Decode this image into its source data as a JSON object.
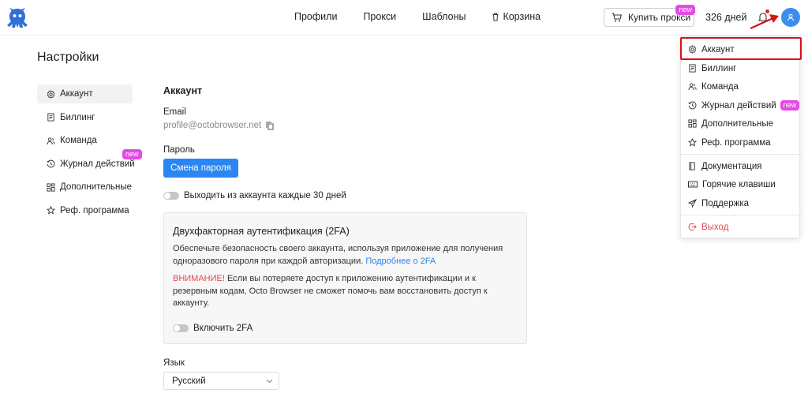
{
  "header": {
    "nav": [
      {
        "label": "Профили",
        "icon": null
      },
      {
        "label": "Прокси",
        "icon": null
      },
      {
        "label": "Шаблоны",
        "icon": null
      },
      {
        "label": "Корзина",
        "icon": "trash-icon"
      }
    ],
    "buy_proxy_label": "Купить прокси",
    "new_badge": "new",
    "days_left": "326 дней"
  },
  "page": {
    "title": "Настройки"
  },
  "sidebar": {
    "items": [
      {
        "label": "Аккаунт",
        "icon": "gear-icon",
        "active": true
      },
      {
        "label": "Биллинг",
        "icon": "receipt-icon"
      },
      {
        "label": "Команда",
        "icon": "team-icon"
      },
      {
        "label": "Журнал действий",
        "icon": "history-icon",
        "badge": "new"
      },
      {
        "label": "Дополнительные",
        "icon": "grid-icon"
      },
      {
        "label": "Реф. программа",
        "icon": "star-icon"
      }
    ]
  },
  "account": {
    "section_title": "Аккаунт",
    "email_label": "Email",
    "email_value": "profile@octobrowser.net",
    "password_label": "Пароль",
    "change_password_label": "Смена пароля",
    "auto_logout_label": "Выходить из аккаунта каждые 30 дней",
    "twofa": {
      "title": "Двухфакторная аутентификация (2FA)",
      "description": "Обеспечьте безопасность своего аккаунта, используя приложение для получения одноразового пароля при каждой авторизации.",
      "link": "Подробнее о 2FA",
      "warning_prefix": "ВНИМАНИЕ!",
      "warning_text": "Если вы потеряете доступ к приложению аутентификации и к резервным кодам, Octo Browser не сможет помочь вам восстановить доступ к аккаунту.",
      "enable_label": "Включить 2FA"
    },
    "language_label": "Язык",
    "language_value": "Русский"
  },
  "user_menu": {
    "items": [
      {
        "label": "Аккаунт",
        "icon": "gear-icon"
      },
      {
        "label": "Биллинг",
        "icon": "receipt-icon"
      },
      {
        "label": "Команда",
        "icon": "team-icon"
      },
      {
        "label": "Журнал действий",
        "icon": "history-icon",
        "badge": "new"
      },
      {
        "label": "Дополнительные",
        "icon": "grid-icon"
      },
      {
        "label": "Реф. программа",
        "icon": "star-icon"
      },
      {
        "label": "Документация",
        "icon": "book-icon"
      },
      {
        "label": "Горячие клавиши",
        "icon": "keyboard-icon"
      },
      {
        "label": "Поддержка",
        "icon": "send-icon"
      },
      {
        "label": "Выход",
        "icon": "logout-icon"
      }
    ]
  },
  "colors": {
    "primary": "#2a86f2",
    "badge": "#e24ce3",
    "danger": "#e5484d",
    "annotation": "#d6121b"
  }
}
